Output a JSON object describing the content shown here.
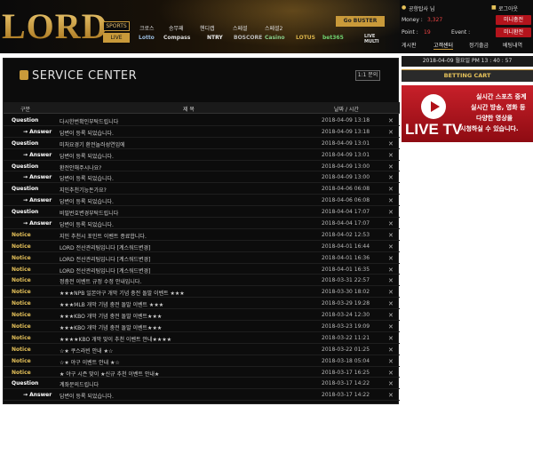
{
  "header": {
    "logo": "LORD",
    "sports_label": "SPORTS",
    "live_label": "LIVE",
    "categories": [
      "크로스",
      "승무패",
      "핸디캡",
      "스페셜",
      "스페셜2"
    ],
    "partners": [
      "Lotto",
      "Compass",
      "NTRY",
      "BOSCORE",
      "Casino",
      "LOTUS",
      "bet365",
      "LIVE MULTI"
    ],
    "promo_label": "Go BUSTER"
  },
  "user": {
    "greeting": "공항탑사 님",
    "logout_label": "로그아웃",
    "money_label": "Money :",
    "money_value": "3,327",
    "point_label": "Point :",
    "point_value": "19",
    "event_label": "Event :",
    "event_value": "",
    "mini1_label": "미니충전",
    "mini2_label": "미니환전",
    "nav": [
      "게시판",
      "고객센터",
      "정기출금",
      "베팅내역"
    ]
  },
  "service": {
    "title": "SERVICE CENTER",
    "inquiry_button": "1:1 문의",
    "headers": {
      "type": "구분",
      "title": "제 목",
      "date": "날짜 / 시간"
    },
    "rows": [
      {
        "type": "Question",
        "kind": "question",
        "title": "다시한번확인부탁드립니다",
        "date": "2018-04-09 13:18",
        "del": "✕"
      },
      {
        "type": "→ Answer",
        "kind": "answer",
        "title": "답변이 등록 되었습니다.",
        "date": "2018-04-09 13:18",
        "del": "✕"
      },
      {
        "type": "Question",
        "kind": "question",
        "title": "미처요경기 환전놀러성연임에",
        "date": "2018-04-09 13:01",
        "del": "✕"
      },
      {
        "type": "→ Answer",
        "kind": "answer",
        "title": "답변이 등록 되었습니다.",
        "date": "2018-04-09 13:01",
        "del": "✕"
      },
      {
        "type": "Question",
        "kind": "question",
        "title": "환전안해주시나요?",
        "date": "2018-04-09 13:00",
        "del": "✕"
      },
      {
        "type": "→ Answer",
        "kind": "answer",
        "title": "답변이 등록 되었습니다.",
        "date": "2018-04-09 13:00",
        "del": "✕"
      },
      {
        "type": "Question",
        "kind": "question",
        "title": "지인추천기능돈가요?",
        "date": "2018-04-06 06:08",
        "del": "✕"
      },
      {
        "type": "→ Answer",
        "kind": "answer",
        "title": "답변이 등록 되었습니다.",
        "date": "2018-04-06 06:08",
        "del": "✕"
      },
      {
        "type": "Question",
        "kind": "question",
        "title": "비밀번호변경부탁드립니다",
        "date": "2018-04-04 17:07",
        "del": "✕"
      },
      {
        "type": "→ Answer",
        "kind": "answer",
        "title": "답변이 등록 되었습니다.",
        "date": "2018-04-04 17:07",
        "del": "✕"
      },
      {
        "type": "Notice",
        "kind": "notice",
        "title": "지인 추천시 포인트 이벤트 종료합니다.",
        "date": "2018-04-02 12:53",
        "del": "✕"
      },
      {
        "type": "Notice",
        "kind": "notice",
        "title": "LORD 전산관리팀입니다 [계스워드변경]",
        "date": "2018-04-01 16:44",
        "del": "✕"
      },
      {
        "type": "Notice",
        "kind": "notice",
        "title": "LORD 전산관리팀입니다 [계스워드변경]",
        "date": "2018-04-01 16:36",
        "del": "✕"
      },
      {
        "type": "Notice",
        "kind": "notice",
        "title": "LORD 전산관리팀입니다 [계스워드변경]",
        "date": "2018-04-01 16:35",
        "del": "✕"
      },
      {
        "type": "Notice",
        "kind": "notice",
        "title": "정충전 이벤트 규정 수정 안내입니다.",
        "date": "2018-03-31 22:57",
        "del": "✕"
      },
      {
        "type": "Notice",
        "kind": "notice",
        "title": "★★★NPB 일본야구 개막 기념  충전 돌발 이벤트 ★★★",
        "date": "2018-03-30 18:02",
        "del": "✕"
      },
      {
        "type": "Notice",
        "kind": "notice",
        "title": "★★★MLB 개막 기념  충전 돌발 이벤트 ★★★",
        "date": "2018-03-29 19:28",
        "del": "✕"
      },
      {
        "type": "Notice",
        "kind": "notice",
        "title": "★★★KBO 개막 기념 충전 돌발 이벤트★★★",
        "date": "2018-03-24 12:30",
        "del": "✕"
      },
      {
        "type": "Notice",
        "kind": "notice",
        "title": "★★★KBO 개막 기념 충전 돌발 이벤트★★★",
        "date": "2018-03-23 19:09",
        "del": "✕"
      },
      {
        "type": "Notice",
        "kind": "notice",
        "title": "★★★★KBO 개막 맞이 추천 이벤트 안내★★★★",
        "date": "2018-03-22 11:21",
        "del": "✕"
      },
      {
        "type": "Notice",
        "kind": "notice",
        "title": "☆★ 쿠스라빈 안내 ★☆",
        "date": "2018-03-22 01:25",
        "del": "✕"
      },
      {
        "type": "Notice",
        "kind": "notice",
        "title": "☆★ 야구 이벤트 안내 ★☆",
        "date": "2018-03-18 05:04",
        "del": "✕"
      },
      {
        "type": "Notice",
        "kind": "notice",
        "title": "★ 야구 시즌  맞이 ★신규 추천 이벤트 안내★",
        "date": "2018-03-17 16:25",
        "del": "✕"
      },
      {
        "type": "Question",
        "kind": "question",
        "title": "계좌문의드립니다",
        "date": "2018-03-17 14:22",
        "del": "✕"
      },
      {
        "type": "→ Answer",
        "kind": "answer",
        "title": "답변이 등록 되었습니다.",
        "date": "2018-03-17 14:22",
        "del": "✕"
      }
    ]
  },
  "sidebar": {
    "datetime": "2018-04-09 월요일 PM 13 : 40 : 57",
    "cart_label": "BETTING CART",
    "banner_live": "LIVE TV",
    "banner_lines": [
      "실시간 스포츠 중계",
      "실시간 방송, 영화 등",
      "다양한 영상을",
      "시청하실 수 있습니다."
    ]
  }
}
